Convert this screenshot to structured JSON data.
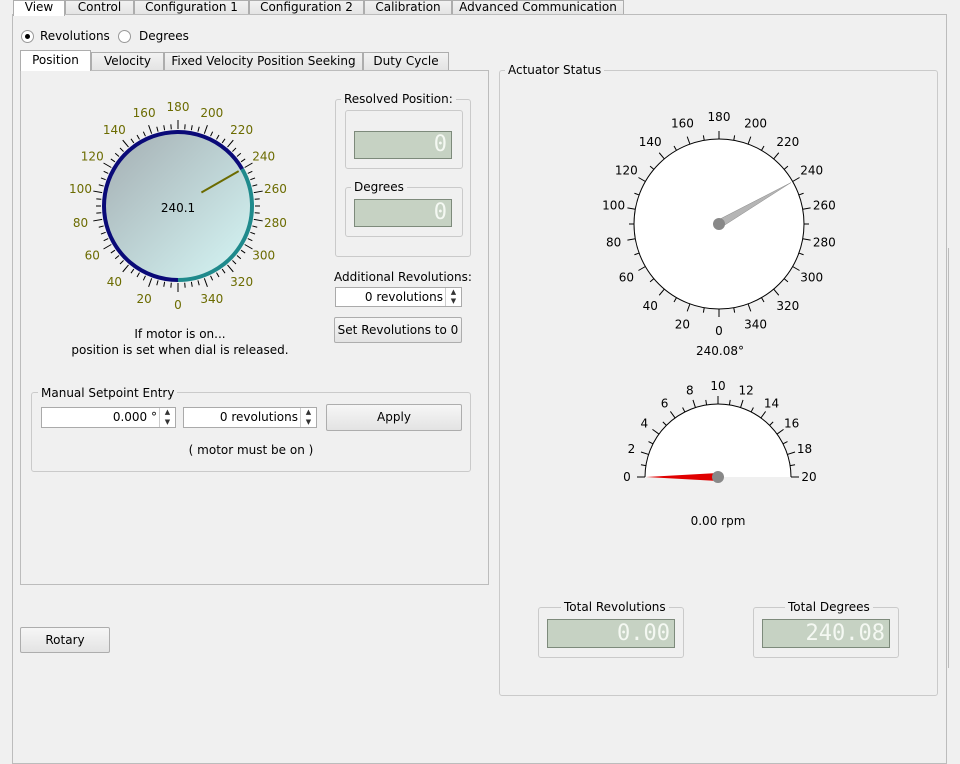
{
  "top_tabs": [
    "View",
    "Control",
    "Configuration 1",
    "Configuration 2",
    "Calibration",
    "Advanced Communication"
  ],
  "units": {
    "revolutions": "Revolutions",
    "degrees": "Degrees",
    "selected": "Revolutions"
  },
  "sub_tabs": [
    "Position",
    "Velocity",
    "Fixed Velocity Position Seeking",
    "Duty Cycle"
  ],
  "dial": {
    "value_text": "240.1",
    "value": 240.1,
    "tick_labels": [
      "0",
      "20",
      "40",
      "60",
      "80",
      "100",
      "120",
      "140",
      "160",
      "180",
      "200",
      "220",
      "240",
      "260",
      "280",
      "300",
      "320",
      "340"
    ],
    "note_line1": "If motor is on...",
    "note_line2": "position is set when dial is released."
  },
  "resolved_position": {
    "title": "Resolved Position:",
    "value": "0"
  },
  "degrees_box": {
    "title": "Degrees",
    "value": "0"
  },
  "additional_revolutions": {
    "label": "Additional Revolutions:",
    "value": "0 revolutions"
  },
  "set_revolutions_button": "Set Revolutions to 0",
  "manual_setpoint": {
    "title": "Manual Setpoint Entry",
    "degrees_value": "0.000 °",
    "revolutions_value": "0 revolutions",
    "apply_label": "Apply",
    "note": "( motor must be on )"
  },
  "rotary_button": "Rotary",
  "actuator_status": {
    "title": "Actuator Status",
    "position_gauge": {
      "value": 240.08,
      "readout": "240.08°",
      "tick_labels": [
        "0",
        "20",
        "40",
        "60",
        "80",
        "100",
        "120",
        "140",
        "160",
        "180",
        "200",
        "220",
        "240",
        "260",
        "280",
        "300",
        "320",
        "340"
      ]
    },
    "speed_gauge": {
      "value": 0.0,
      "readout": "0.00 rpm",
      "tick_labels": [
        "0",
        "2",
        "4",
        "6",
        "8",
        "10",
        "12",
        "14",
        "16",
        "18",
        "20"
      ]
    },
    "total_revolutions": {
      "title": "Total Revolutions",
      "value": "0.00"
    },
    "total_degrees": {
      "title": "Total Degrees",
      "value": "240.08"
    }
  },
  "colors": {
    "dial_ring_dark": "#0a0a78",
    "dial_ring_teal": "#1f8a8c",
    "needle_red": "#e00000",
    "tick_label_olive": "#6b6b00"
  }
}
